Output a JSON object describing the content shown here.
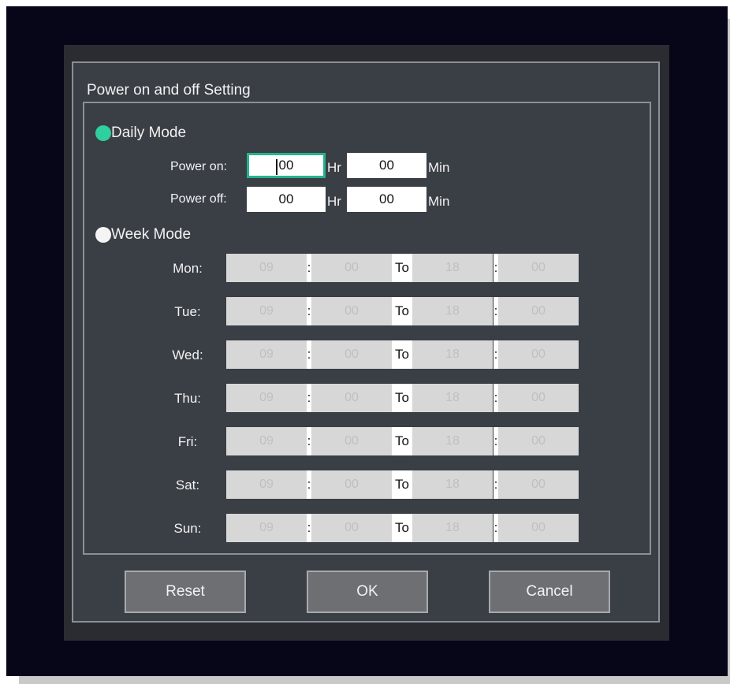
{
  "dialog": {
    "title": "Power on and off Setting"
  },
  "daily_mode": {
    "label": "Daily Mode",
    "selected": true,
    "power_on_label": "Power on:",
    "power_off_label": "Power off:",
    "power_on_hr": "00",
    "power_on_min": "00",
    "power_off_hr": "00",
    "power_off_min": "00",
    "hr_unit": "Hr",
    "min_unit": "Min"
  },
  "week_mode": {
    "label": "Week Mode",
    "selected": false,
    "to_label": "To",
    "separator": ":",
    "days": [
      {
        "day": "Mon:",
        "start_hr": "09",
        "start_min": "00",
        "end_hr": "18",
        "end_min": "00"
      },
      {
        "day": "Tue:",
        "start_hr": "09",
        "start_min": "00",
        "end_hr": "18",
        "end_min": "00"
      },
      {
        "day": "Wed:",
        "start_hr": "09",
        "start_min": "00",
        "end_hr": "18",
        "end_min": "00"
      },
      {
        "day": "Thu:",
        "start_hr": "09",
        "start_min": "00",
        "end_hr": "18",
        "end_min": "00"
      },
      {
        "day": "Fri:",
        "start_hr": "09",
        "start_min": "00",
        "end_hr": "18",
        "end_min": "00"
      },
      {
        "day": "Sat:",
        "start_hr": "09",
        "start_min": "00",
        "end_hr": "18",
        "end_min": "00"
      },
      {
        "day": "Sun:",
        "start_hr": "09",
        "start_min": "00",
        "end_hr": "18",
        "end_min": "00"
      }
    ]
  },
  "buttons": {
    "reset": "Reset",
    "ok": "OK",
    "cancel": "Cancel"
  },
  "colors": {
    "accent": "#2fcf9f",
    "screen_bg": "#070619",
    "dialog_bg": "#3a3e45"
  }
}
